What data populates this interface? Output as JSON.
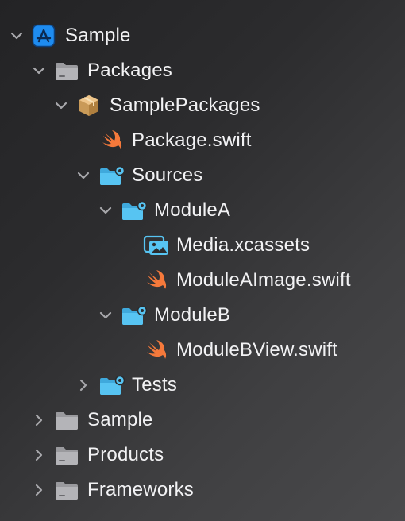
{
  "tree": {
    "root": {
      "label": "Sample",
      "icon": "app-project-icon",
      "state": "expanded"
    },
    "packages": {
      "label": "Packages",
      "icon": "folder-icon",
      "state": "expanded"
    },
    "sample_packages": {
      "label": "SamplePackages",
      "icon": "package-box-icon",
      "state": "expanded"
    },
    "package_swift": {
      "label": "Package.swift",
      "icon": "swift-icon"
    },
    "sources": {
      "label": "Sources",
      "icon": "module-folder-icon",
      "state": "expanded"
    },
    "module_a": {
      "label": "ModuleA",
      "icon": "module-folder-icon",
      "state": "expanded"
    },
    "media_xcassets": {
      "label": "Media.xcassets",
      "icon": "asset-catalog-icon"
    },
    "module_a_image": {
      "label": "ModuleAImage.swift",
      "icon": "swift-icon"
    },
    "module_b": {
      "label": "ModuleB",
      "icon": "module-folder-icon",
      "state": "expanded"
    },
    "module_b_view": {
      "label": "ModuleBView.swift",
      "icon": "swift-icon"
    },
    "tests": {
      "label": "Tests",
      "icon": "module-folder-icon",
      "state": "collapsed"
    },
    "sample_folder": {
      "label": "Sample",
      "icon": "folder-icon",
      "state": "collapsed"
    },
    "products": {
      "label": "Products",
      "icon": "folder-icon",
      "state": "collapsed"
    },
    "frameworks": {
      "label": "Frameworks",
      "icon": "folder-icon",
      "state": "collapsed"
    }
  },
  "colors": {
    "text": "#f2f2f4",
    "chevron": "#a8a8ac",
    "folder_gray": "#9a9a9e",
    "module_blue": "#57c4f2",
    "app_blue": "#1e8cf0",
    "swift_orange": "#f5793b",
    "package_tan": "#e0b16c"
  }
}
